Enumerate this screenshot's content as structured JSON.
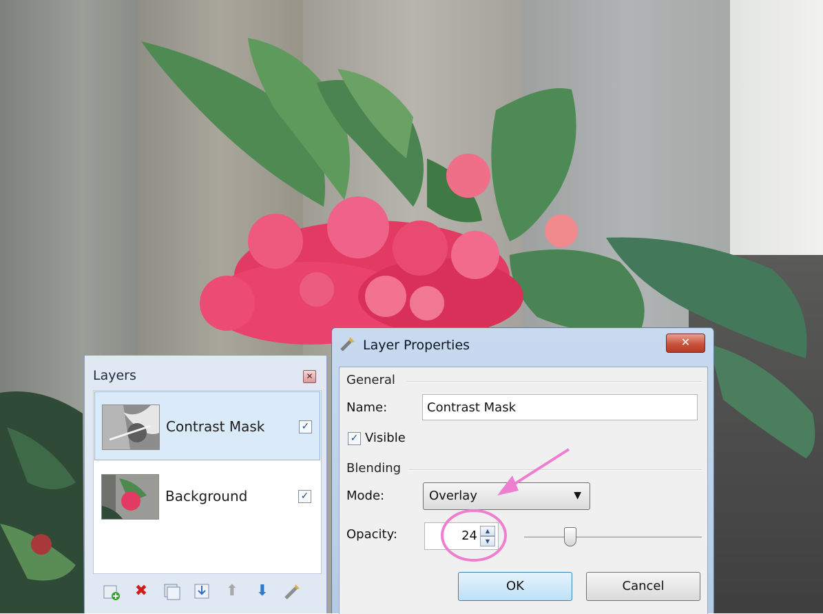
{
  "layers_panel": {
    "title": "Layers",
    "items": [
      {
        "name": "Contrast Mask",
        "visible": true,
        "selected": true
      },
      {
        "name": "Background",
        "visible": true,
        "selected": false
      }
    ],
    "toolbar": [
      {
        "icon": "add-layer-icon"
      },
      {
        "icon": "delete-layer-icon"
      },
      {
        "icon": "duplicate-layer-icon"
      },
      {
        "icon": "merge-layer-down-icon"
      },
      {
        "icon": "move-layer-up-icon"
      },
      {
        "icon": "move-layer-down-icon"
      },
      {
        "icon": "layer-properties-icon"
      }
    ]
  },
  "dialog": {
    "title": "Layer Properties",
    "general_label": "General",
    "name_label": "Name:",
    "name_value": "Contrast Mask",
    "visible_label": "Visible",
    "visible_checked": true,
    "blending_label": "Blending",
    "mode_label": "Mode:",
    "mode_value": "Overlay",
    "opacity_label": "Opacity:",
    "opacity_value": "24",
    "ok_label": "OK",
    "cancel_label": "Cancel"
  },
  "colors": {
    "annotation": "#ee7fd0",
    "flower": "#e63a64"
  }
}
